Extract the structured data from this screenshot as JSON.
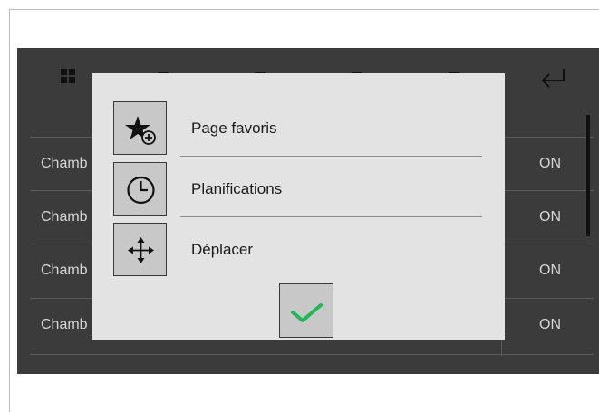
{
  "background_list": {
    "rows": [
      {
        "label": "Chamb",
        "state": "ON"
      },
      {
        "label": "Chamb",
        "state": "ON"
      },
      {
        "label": "Chamb",
        "state": "ON"
      },
      {
        "label": "Chamb",
        "state": "ON"
      }
    ]
  },
  "dialog": {
    "items": [
      {
        "label": "Page favoris",
        "icon": "star-add-icon"
      },
      {
        "label": "Planifications",
        "icon": "clock-icon"
      },
      {
        "label": "Déplacer",
        "icon": "move-arrows-icon"
      }
    ],
    "confirm_icon": "checkmark-icon"
  },
  "colors": {
    "screen_background": "#3b3b3b",
    "dialog_background": "#e3e3e3",
    "confirm_check": "#1db954"
  }
}
